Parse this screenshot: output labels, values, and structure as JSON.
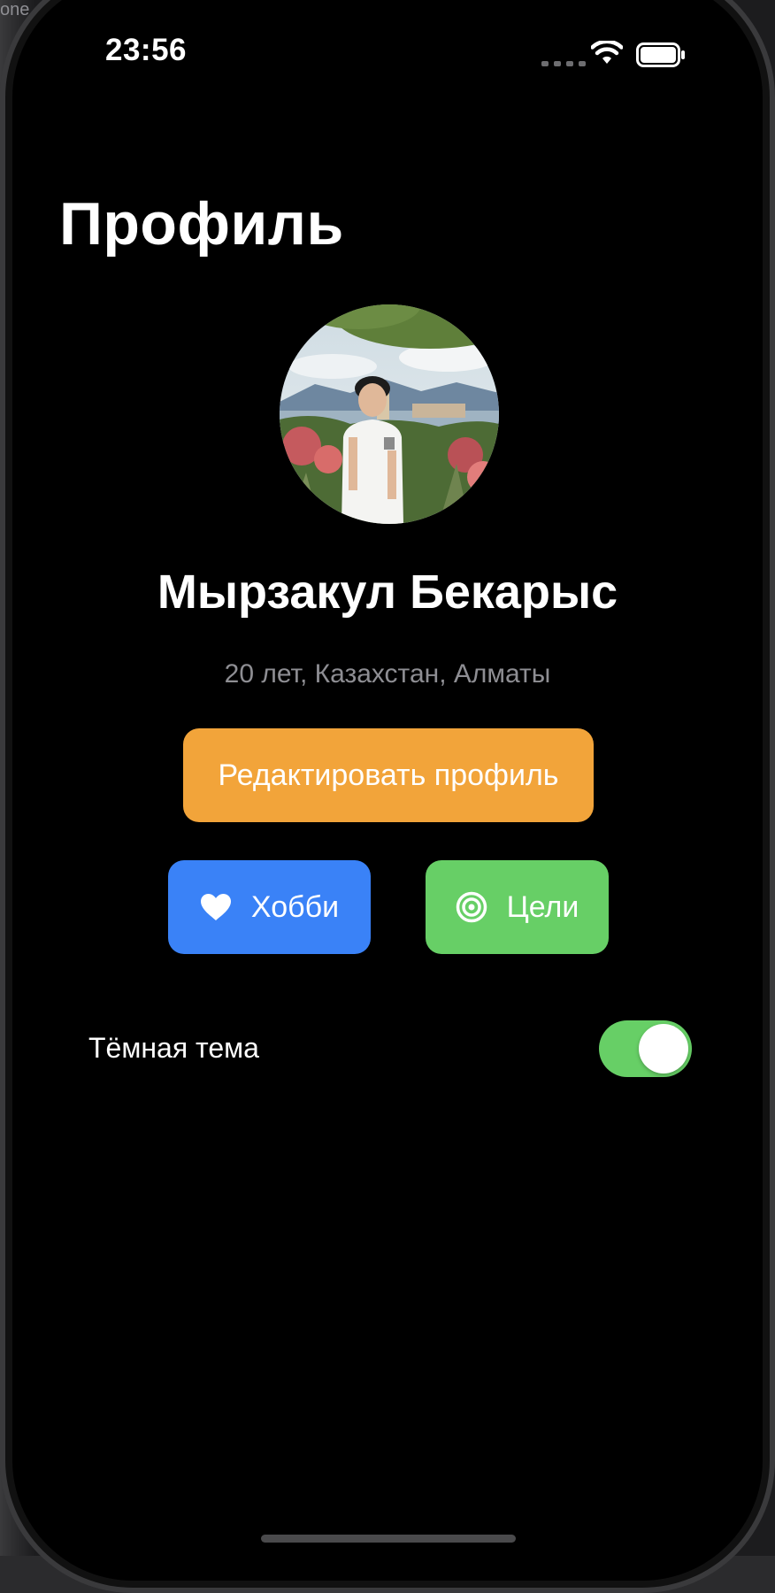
{
  "simulator": {
    "label": "one"
  },
  "status_bar": {
    "time": "23:56"
  },
  "header": {
    "title": "Профиль"
  },
  "profile": {
    "name": "Мырзакул Бекарыс",
    "meta": "20 лет, Казахстан, Алматы",
    "edit_label": "Редактировать профиль"
  },
  "actions": {
    "hobby_label": "Хобби",
    "goals_label": "Цели"
  },
  "settings": {
    "dark_theme_label": "Тёмная тема",
    "dark_theme_enabled": true
  },
  "colors": {
    "background": "#000000",
    "edit_button": "#f2a43a",
    "hobby_button": "#3a82f7",
    "goals_button": "#67cf66",
    "toggle_on": "#67cf66",
    "secondary_text": "#8e8e93"
  },
  "icons": {
    "hobby": "heart-icon",
    "goals": "target-icon",
    "status": [
      "cellular-signal-icon",
      "wifi-icon",
      "battery-icon"
    ]
  }
}
